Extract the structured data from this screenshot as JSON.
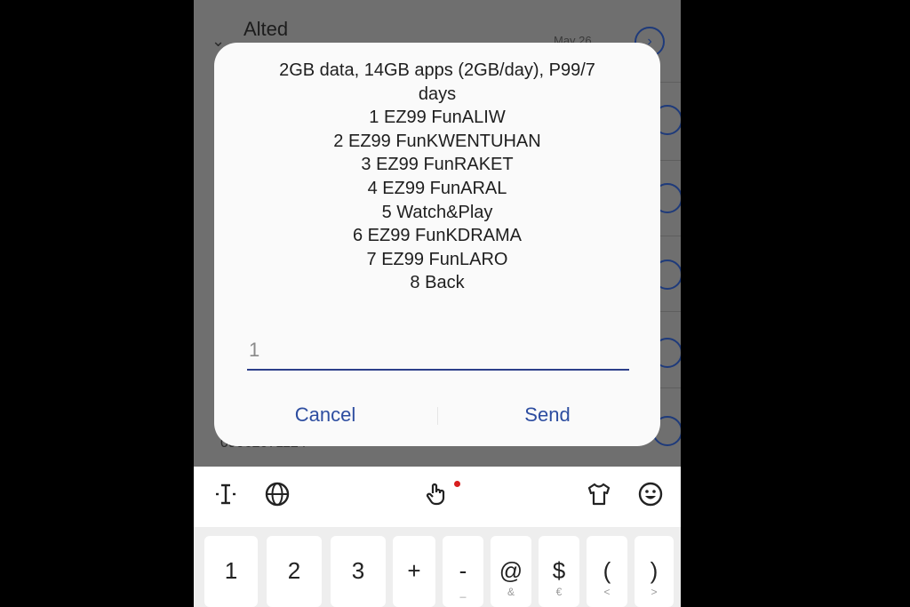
{
  "background_app": {
    "header": "Alted",
    "date": "May 26",
    "phone_partial": "09062071124"
  },
  "dialog": {
    "message_lines": [
      "2GB data, 14GB apps (2GB/day), P99/7",
      "days",
      "1 EZ99 FunALIW",
      "2 EZ99 FunKWENTUHAN",
      "3 EZ99 FunRAKET",
      "4 EZ99 FunARAL",
      "5 Watch&Play",
      "6 EZ99 FunKDRAMA",
      "7 EZ99 FunLARO",
      "8 Back"
    ],
    "input_value": "1",
    "cancel_label": "Cancel",
    "send_label": "Send"
  },
  "keyboard": {
    "toolbar_icons": [
      "text-cursor-icon",
      "globe-icon",
      "hand-stickers-icon",
      "shirt-theme-icon",
      "smiley-emoji-icon"
    ],
    "keys": [
      {
        "main": "1",
        "sub": ""
      },
      {
        "main": "2",
        "sub": ""
      },
      {
        "main": "3",
        "sub": ""
      },
      {
        "main": "+",
        "sub": ""
      },
      {
        "main": "-",
        "sub": "_"
      },
      {
        "main": "@",
        "sub": "&"
      },
      {
        "main": "$",
        "sub": "€"
      },
      {
        "main": "(",
        "sub": "<"
      },
      {
        "main": ")",
        "sub": ">"
      }
    ]
  },
  "colors": {
    "accent": "#2d4da0",
    "underline": "#2d3f8a",
    "dim_background": "#6f6f6f",
    "notification_dot": "#d81e1e"
  }
}
